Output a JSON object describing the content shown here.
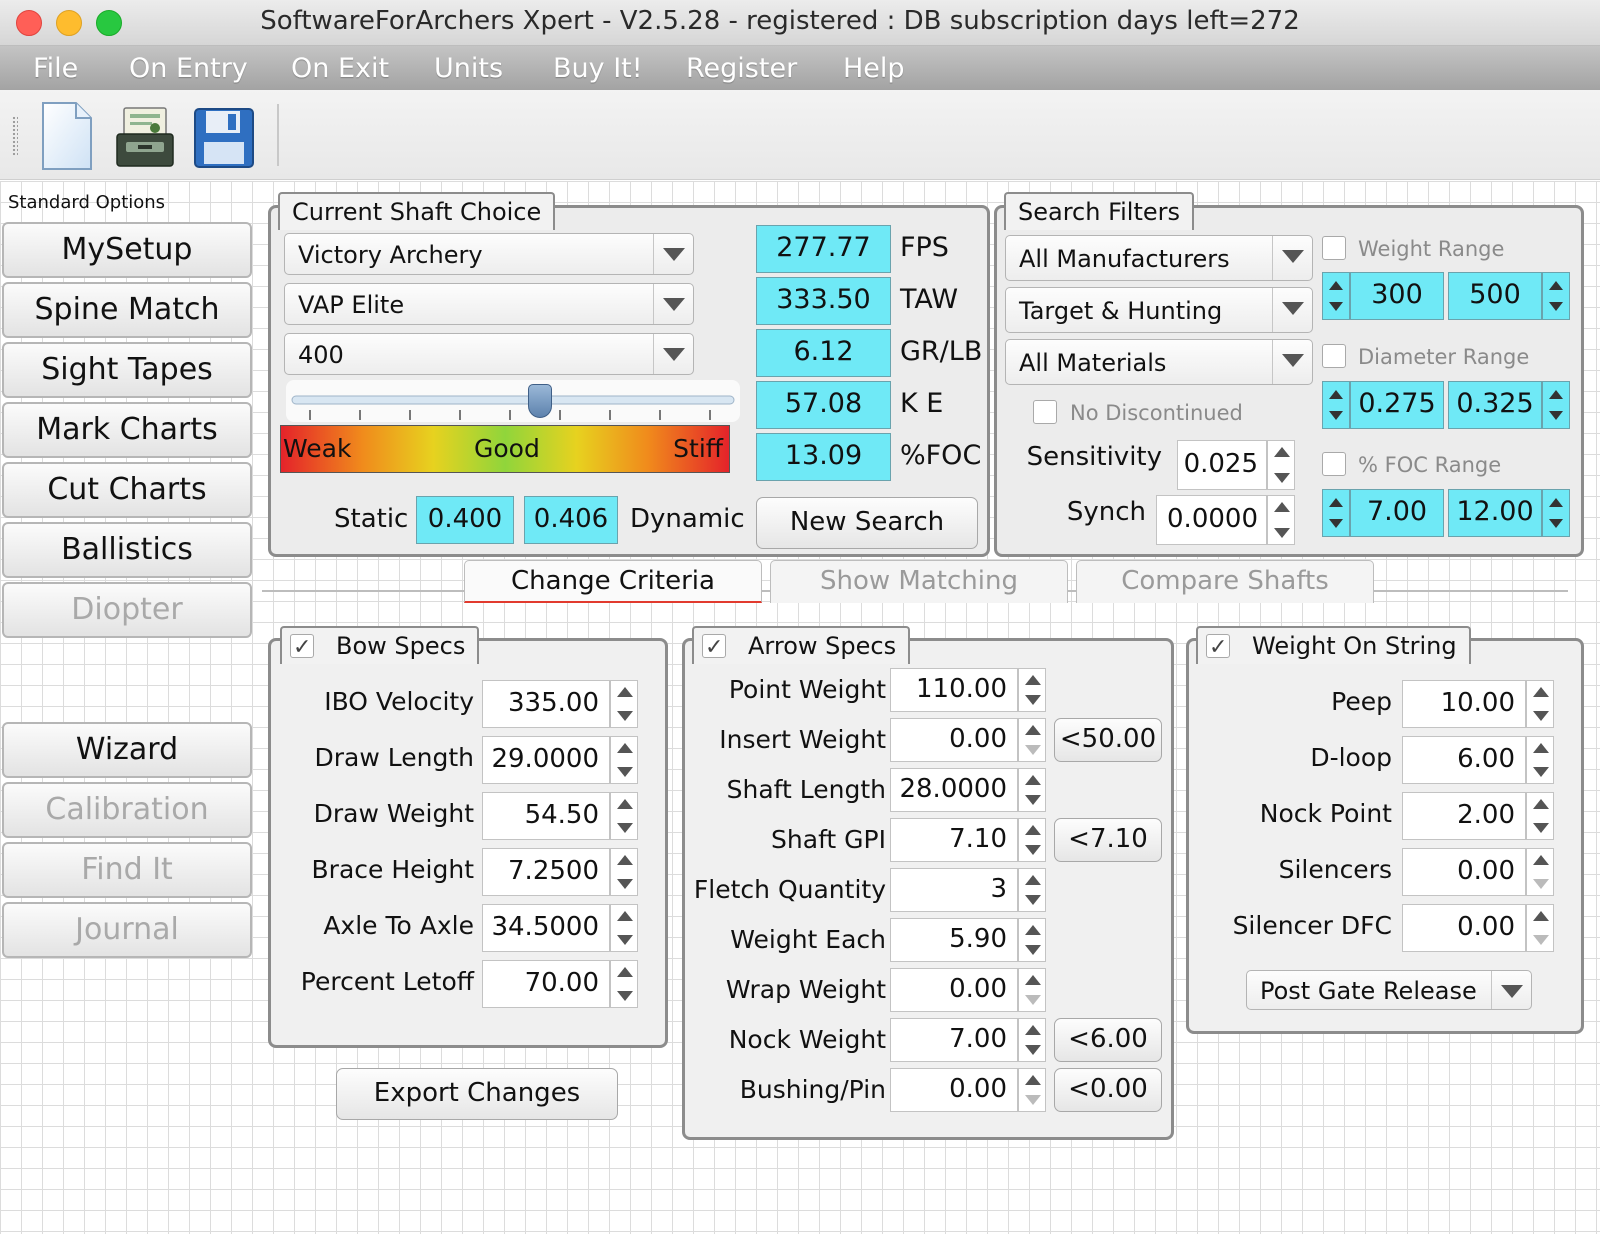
{
  "window": {
    "title": "SoftwareForArchers Xpert - V2.5.28 - registered : DB subscription days left=272"
  },
  "menu": [
    "File",
    "On Entry",
    "On Exit",
    "Units",
    "Buy It!",
    "Register",
    "Help"
  ],
  "toolbar": {
    "icons": [
      "new-document-icon",
      "database-icon",
      "save-icon"
    ]
  },
  "sidebar": {
    "caption": "Standard Options",
    "top_buttons": [
      {
        "label": "MySetup",
        "enabled": true
      },
      {
        "label": "Spine Match",
        "enabled": true
      },
      {
        "label": "Sight Tapes",
        "enabled": true
      },
      {
        "label": "Mark Charts",
        "enabled": true
      },
      {
        "label": "Cut Charts",
        "enabled": true
      },
      {
        "label": "Ballistics",
        "enabled": true
      },
      {
        "label": "Diopter",
        "enabled": false
      }
    ],
    "bottom_buttons": [
      {
        "label": "Wizard",
        "enabled": true
      },
      {
        "label": "Calibration",
        "enabled": false
      },
      {
        "label": "Find It",
        "enabled": false
      },
      {
        "label": "Journal",
        "enabled": false
      }
    ]
  },
  "shaft_choice": {
    "title": "Current Shaft Choice",
    "manufacturer": "Victory Archery",
    "model": "VAP Elite",
    "spine": "400",
    "slider_fraction": 0.55,
    "stiffness_labels": {
      "weak": "Weak",
      "good": "Good",
      "stiff": "Stiff"
    },
    "metrics": [
      {
        "value": "277.77",
        "unit": "FPS"
      },
      {
        "value": "333.50",
        "unit": "TAW"
      },
      {
        "value": "6.12",
        "unit": "GR/LB"
      },
      {
        "value": "57.08",
        "unit": "K E"
      },
      {
        "value": "13.09",
        "unit": "%FOC"
      }
    ],
    "static_label": "Static",
    "static_value": "0.400",
    "dynamic_value": "0.406",
    "dynamic_label": "Dynamic",
    "new_search_label": "New Search"
  },
  "search_filters": {
    "title": "Search Filters",
    "manufacturers": "All Manufacturers",
    "category": "Target & Hunting",
    "materials": "All Materials",
    "no_discontinued_label": "No Discontinued",
    "sensitivity_label": "Sensitivity",
    "sensitivity_value": "0.025",
    "synch_label": "Synch",
    "synch_value": "0.0000",
    "weight_range": {
      "label": "Weight Range",
      "min": "300",
      "max": "500"
    },
    "diameter_range": {
      "label": "Diameter Range",
      "min": "0.275",
      "max": "0.325"
    },
    "foc_range": {
      "label": "% FOC Range",
      "min": "7.00",
      "max": "12.00"
    }
  },
  "tabs": [
    {
      "label": "Change Criteria",
      "active": true
    },
    {
      "label": "Show Matching",
      "active": false
    },
    {
      "label": "Compare Shafts",
      "active": false
    }
  ],
  "bow_specs": {
    "title": "Bow Specs",
    "fields": [
      {
        "label": "IBO Velocity",
        "value": "335.00"
      },
      {
        "label": "Draw Length",
        "value": "29.0000"
      },
      {
        "label": "Draw Weight",
        "value": "54.50"
      },
      {
        "label": "Brace Height",
        "value": "7.2500"
      },
      {
        "label": "Axle To Axle",
        "value": "34.5000"
      },
      {
        "label": "Percent Letoff",
        "value": "70.00"
      }
    ],
    "export_label": "Export Changes"
  },
  "arrow_specs": {
    "title": "Arrow Specs",
    "fields": [
      {
        "label": "Point Weight",
        "value": "110.00",
        "side": ""
      },
      {
        "label": "Insert Weight",
        "value": "0.00",
        "side": "<50.00"
      },
      {
        "label": "Shaft Length",
        "value": "28.0000",
        "side": ""
      },
      {
        "label": "Shaft GPI",
        "value": "7.10",
        "side": "<7.10"
      },
      {
        "label": "Fletch Quantity",
        "value": "3",
        "side": ""
      },
      {
        "label": "Weight Each",
        "value": "5.90",
        "side": ""
      },
      {
        "label": "Wrap Weight",
        "value": "0.00",
        "side": ""
      },
      {
        "label": "Nock Weight",
        "value": "7.00",
        "side": "<6.00"
      },
      {
        "label": "Bushing/Pin",
        "value": "0.00",
        "side": "<0.00"
      }
    ]
  },
  "weight_on_string": {
    "title": "Weight On String",
    "fields": [
      {
        "label": "Peep",
        "value": "10.00"
      },
      {
        "label": "D-loop",
        "value": "6.00"
      },
      {
        "label": "Nock Point",
        "value": "2.00"
      },
      {
        "label": "Silencers",
        "value": "0.00"
      },
      {
        "label": "Silencer DFC",
        "value": "0.00"
      }
    ],
    "release": "Post Gate Release"
  }
}
